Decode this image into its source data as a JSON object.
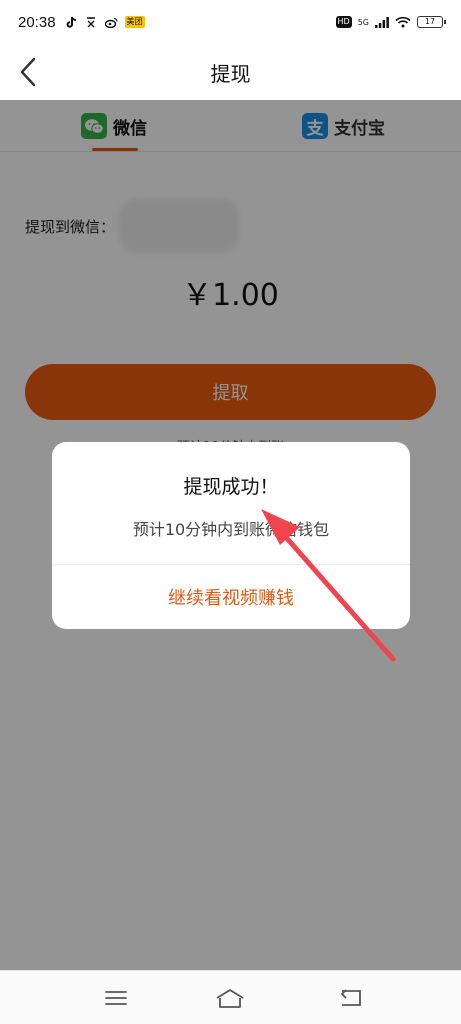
{
  "status_bar": {
    "time": "20:38",
    "left_icons": [
      "tiktok-icon",
      "text-icon",
      "weibo-icon",
      "app-badge-icon"
    ],
    "app_badge_text": "美团",
    "hd_label": "HD",
    "network_label": "5G",
    "battery_level": "17"
  },
  "header": {
    "title": "提现"
  },
  "tabs": [
    {
      "label": "微信",
      "icon": "wechat-icon",
      "active": true
    },
    {
      "label": "支付宝",
      "icon": "alipay-icon",
      "active": false
    }
  ],
  "alipay_icon_glyph": "支",
  "withdraw": {
    "destination_label": "提现到微信：",
    "amount": "￥1.00",
    "button_label": "提取",
    "hint": "预计10分钟内到账"
  },
  "dialog": {
    "title": "提现成功！",
    "message": "预计10分钟内到账微信钱包",
    "action_label": "继续看视频赚钱"
  },
  "colors": {
    "accent": "#ec5b11",
    "dialog_action": "#e35a14",
    "annotation_arrow": "#f0444f",
    "wechat_green": "#35b448",
    "alipay_blue": "#1a8fe3"
  },
  "nav_bar": {
    "icons": [
      "menu-icon",
      "home-icon",
      "back-icon"
    ]
  }
}
